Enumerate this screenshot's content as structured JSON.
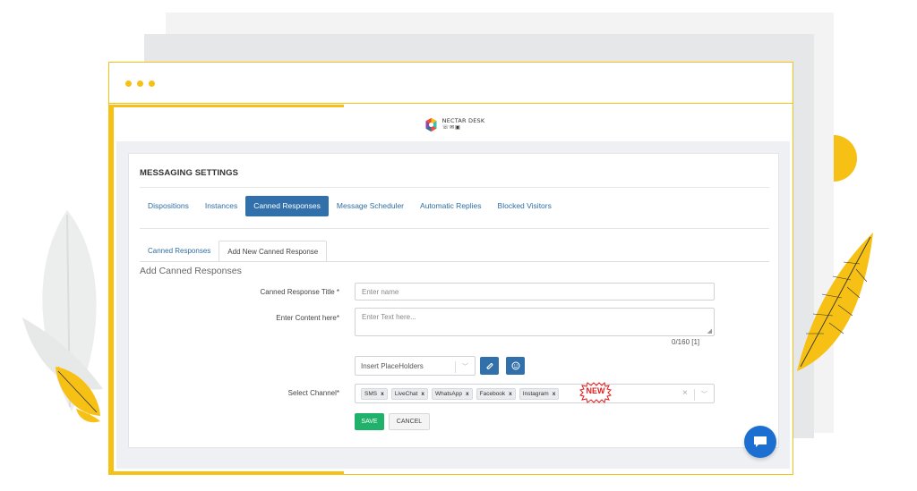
{
  "brand": {
    "name": "NECTAR DESK",
    "icons": "☏✉▣"
  },
  "settings": {
    "title": "MESSAGING SETTINGS"
  },
  "tabs": [
    {
      "label": "Dispositions",
      "active": false
    },
    {
      "label": "Instances",
      "active": false
    },
    {
      "label": "Canned Responses",
      "active": true
    },
    {
      "label": "Message Scheduler",
      "active": false
    },
    {
      "label": "Automatic Replies",
      "active": false
    },
    {
      "label": "Blocked Visitors",
      "active": false
    }
  ],
  "subtabs": [
    {
      "label": "Canned Responses",
      "active": false
    },
    {
      "label": "Add New Canned Response",
      "active": true
    }
  ],
  "form": {
    "title": "Add Canned Responses",
    "title_label": "Canned Response Title *",
    "title_placeholder": "Enter name",
    "content_label": "Enter Content here*",
    "content_placeholder": "Enter Text here...",
    "counter": "0/160 [1]",
    "placeholder_select": "Insert PlaceHolders",
    "channel_label": "Select Channel*",
    "channels": [
      {
        "label": "SMS",
        "remove": "x"
      },
      {
        "label": "LiveChat",
        "remove": "x"
      },
      {
        "label": "WhatsApp",
        "remove": "x"
      },
      {
        "label": "Facebook",
        "remove": "x"
      },
      {
        "label": "Instagram",
        "remove": "x"
      }
    ],
    "clear": "×",
    "save": "SAVE",
    "cancel": "CANCEL"
  },
  "badge": {
    "text": "NEW",
    "color": "#e02020"
  },
  "colors": {
    "accent": "#f6c015",
    "primary": "#3170ab",
    "success": "#20b26b",
    "chat": "#1a6fd0"
  }
}
